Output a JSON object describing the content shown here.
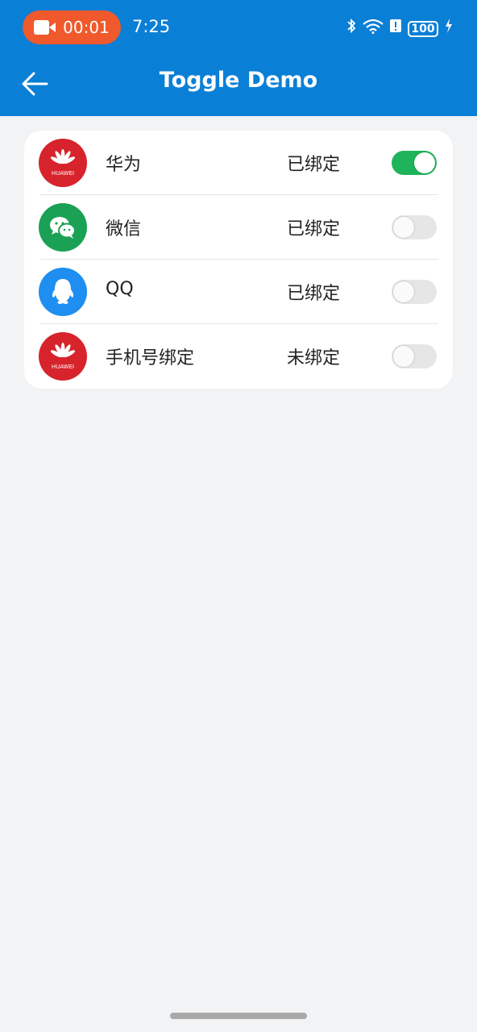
{
  "status_bar": {
    "recording_time": "00:01",
    "clock": "7:25",
    "battery": "100",
    "icons": [
      "bluetooth-icon",
      "wifi-icon",
      "alert-icon",
      "battery-icon",
      "charging-icon"
    ]
  },
  "app_bar": {
    "title": "Toggle Demo",
    "back_icon": "arrow-left-icon",
    "color": "#0a7fd6"
  },
  "accounts": [
    {
      "name": "华为",
      "status": "已绑定",
      "toggle_on": true,
      "icon": "huawei-logo-icon",
      "icon_color": "#d7232b",
      "logo_text": "HUAWEI"
    },
    {
      "name": "微信",
      "status": "已绑定",
      "toggle_on": false,
      "icon": "wechat-logo-icon",
      "icon_color": "#1aa155"
    },
    {
      "name": "QQ",
      "status": "已绑定",
      "toggle_on": false,
      "icon": "qq-logo-icon",
      "icon_color": "#1e8ef0"
    },
    {
      "name": "手机号绑定",
      "status": "未绑定",
      "toggle_on": false,
      "icon": "huawei-logo-icon",
      "icon_color": "#d7232b",
      "logo_text": "HUAWEI"
    }
  ],
  "colors": {
    "toggle_on": "#1fb45a",
    "toggle_off": "#e6e6e6",
    "recording_pill": "#f0592b"
  }
}
